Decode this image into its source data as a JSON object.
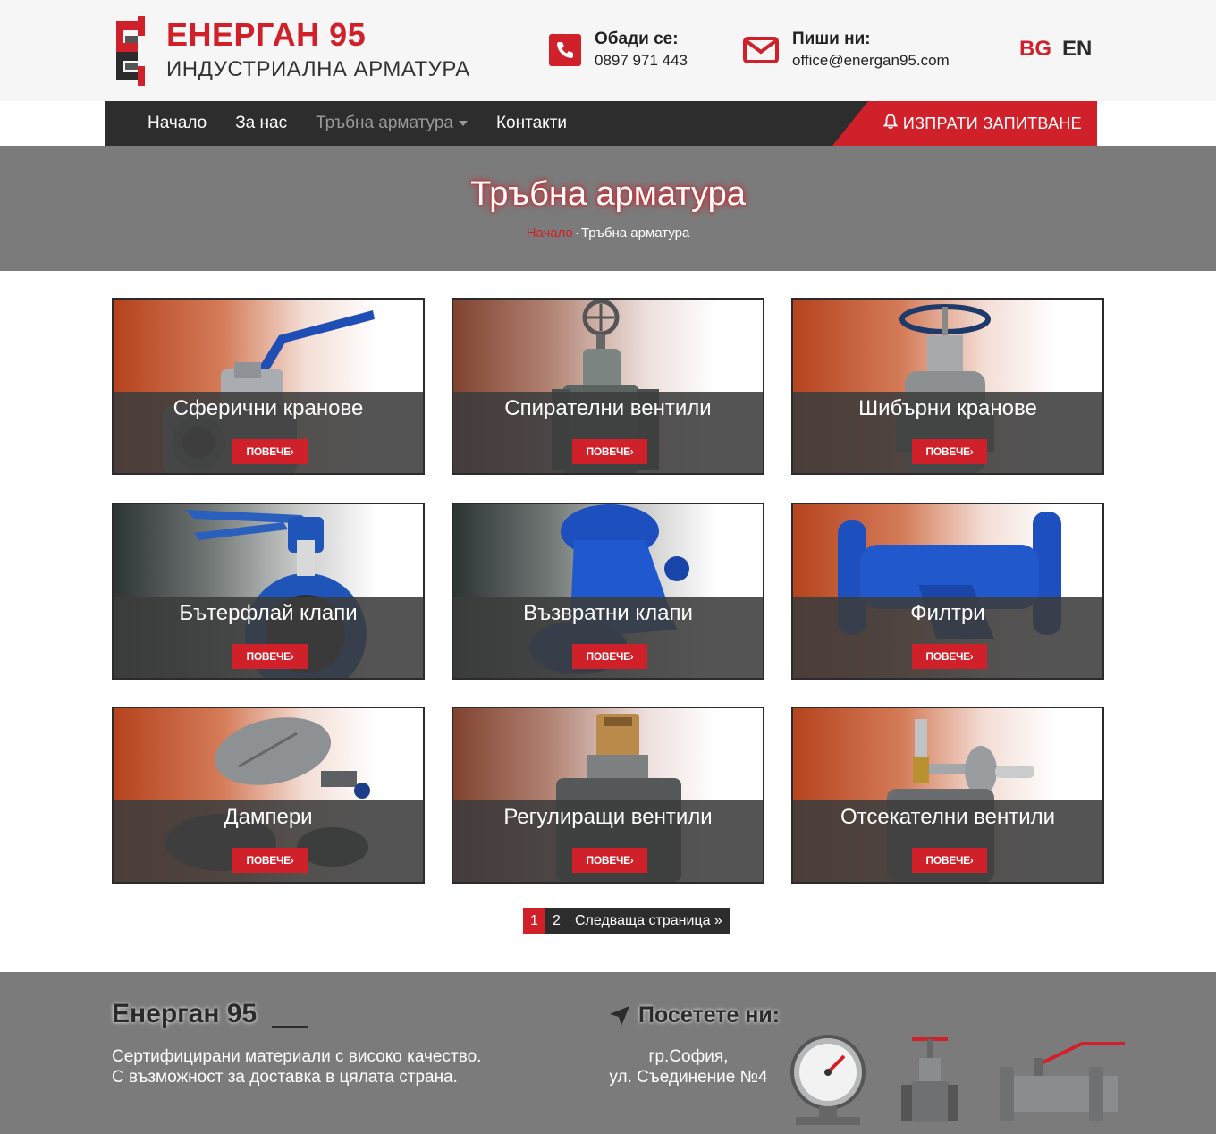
{
  "header": {
    "brand_title": "ЕНЕРГАН 95",
    "brand_subtitle": "ИНДУСТРИАЛНА АРМАТУРА",
    "phone_label": "Обади се:",
    "phone_value": "0897 971 443",
    "email_label": "Пиши ни:",
    "email_value": "office@energan95.com",
    "lang_bg": "BG",
    "lang_en": "EN"
  },
  "nav": {
    "items": [
      "Начало",
      "За нас",
      "Тръбна арматура",
      "Контакти"
    ],
    "inquiry_label": "ИЗПРАТИ ЗАПИТВАНЕ"
  },
  "hero": {
    "title": "Тръбна арматура",
    "crumb_home": "Начало",
    "crumb_sep": "·",
    "crumb_current": "Тръбна арматура"
  },
  "products": {
    "more_label": "ПОВЕЧЕ",
    "items": [
      {
        "title": "Сферични кранове",
        "icon": "ball-valve-icon"
      },
      {
        "title": "Спирателни вентили",
        "icon": "globe-valve-icon"
      },
      {
        "title": "Шибърни кранове",
        "icon": "gate-valve-icon"
      },
      {
        "title": "Бътерфлай клапи",
        "icon": "butterfly-valve-icon"
      },
      {
        "title": "Възвратни клапи",
        "icon": "check-valve-icon"
      },
      {
        "title": "Филтри",
        "icon": "filter-icon"
      },
      {
        "title": "Дампери",
        "icon": "damper-icon"
      },
      {
        "title": "Регулиращи вентили",
        "icon": "control-valve-icon"
      },
      {
        "title": "Отсекателни вентили",
        "icon": "shutoff-valve-icon"
      }
    ]
  },
  "pagination": {
    "page1": "1",
    "page2": "2",
    "next": "Следваща страница »"
  },
  "footer": {
    "title": "Енерган 95",
    "text_line1": "Сертифицирани материали с високо качество.",
    "text_line2": "С възможност за доставка в цялата страна.",
    "visit_label": "Посетете ни:",
    "addr_line1": "гр.София,",
    "addr_line2": "ул. Съединение №4"
  },
  "colors": {
    "accent": "#d0212a",
    "nav_bg": "#2d2d2d",
    "hero_bg": "#7b7b7b",
    "header_bg": "#f6f6f6"
  }
}
